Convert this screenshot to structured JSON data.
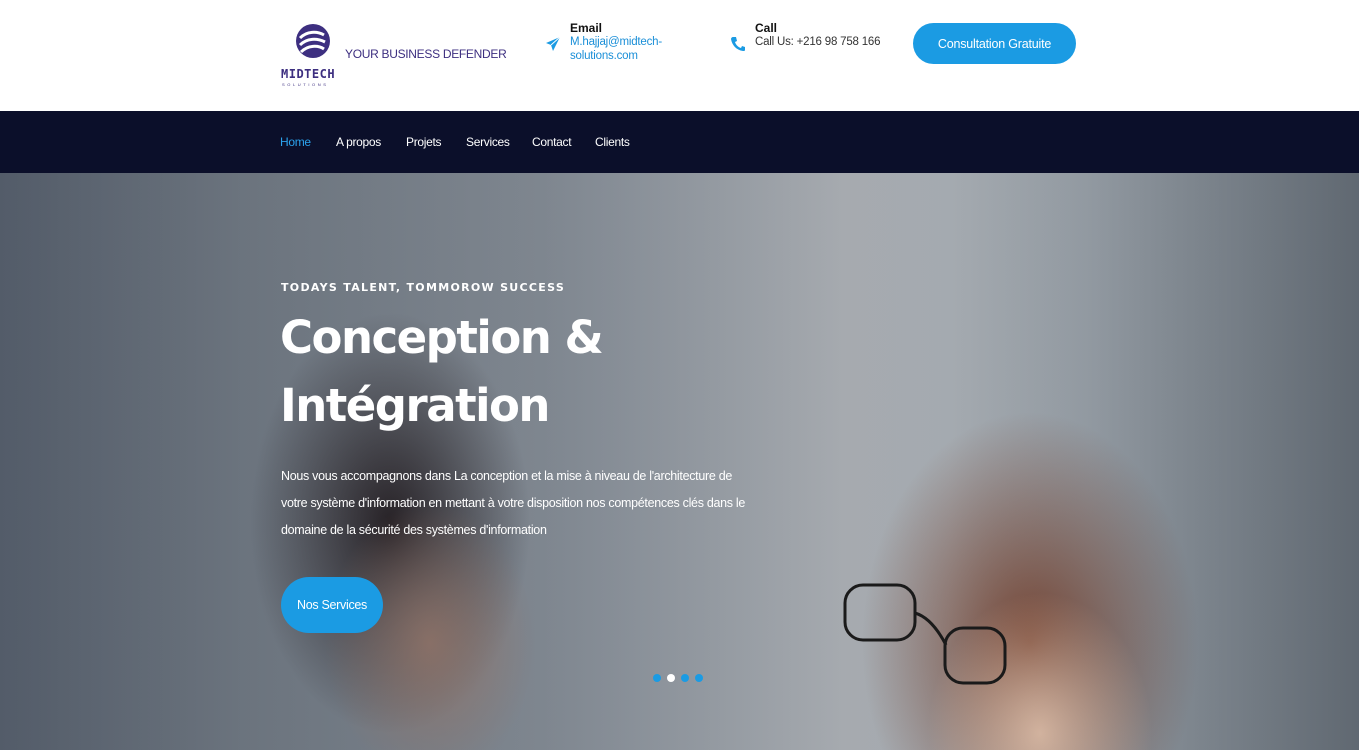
{
  "brand": {
    "logo_word": "MIDTECH",
    "logo_sub": "SOLUTIONS",
    "tagline": "YOUR BUSINESS DEFENDER",
    "color": "#3d2f80"
  },
  "contact": {
    "email": {
      "title": "Email",
      "value": "M.hajjaj@midtech-solutions.com",
      "icon": "paper-plane-icon"
    },
    "call": {
      "title": "Call",
      "value": "Call Us: +216 98 758 166",
      "icon": "phone-icon"
    }
  },
  "header_cta": {
    "label": "Consultation Gratuite"
  },
  "nav": {
    "items": [
      {
        "label": "Home",
        "active": true
      },
      {
        "label": "A propos",
        "active": false
      },
      {
        "label": "Projets",
        "active": false
      },
      {
        "label": "Services",
        "active": false
      },
      {
        "label": "Contact",
        "active": false
      },
      {
        "label": "Clients",
        "active": false
      }
    ]
  },
  "hero": {
    "kicker": "TODAYS TALENT, TOMMOROW SUCCESS",
    "title_line1": "Conception &",
    "title_line2": "Intégration",
    "description": "Nous vous accompagnons dans La conception et la mise à niveau de l'architecture de votre système d'information en mettant à votre disposition nos compétences clés dans le domaine de la sécurité des systèmes d'information",
    "cta_label": "Nos Services",
    "slides_count": 4,
    "active_slide": 2
  },
  "colors": {
    "accent": "#1b9be3",
    "navbar": "#0b0f2a",
    "nav_active": "#2ba3ee"
  }
}
